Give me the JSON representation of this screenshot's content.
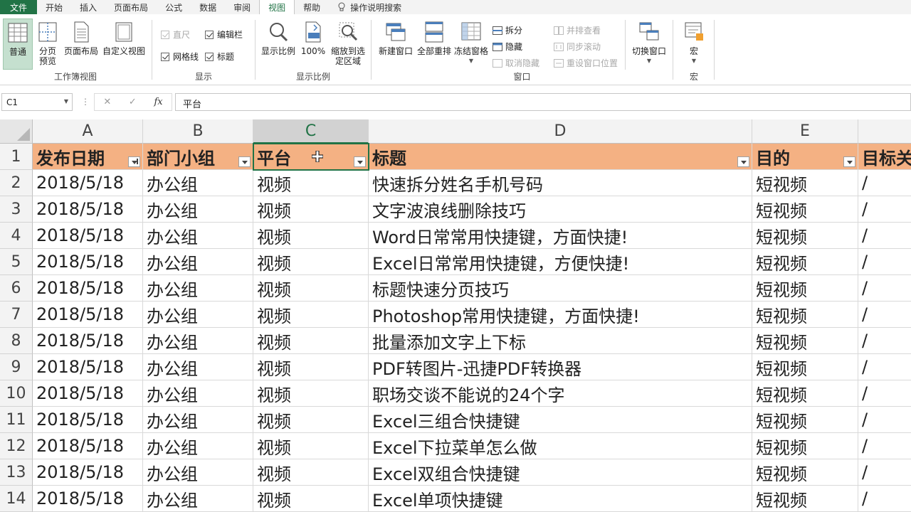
{
  "tabs": [
    "文件",
    "开始",
    "插入",
    "页面布局",
    "公式",
    "数据",
    "审阅",
    "视图",
    "帮助",
    "操作说明搜索"
  ],
  "ribbon": {
    "workbook_views": {
      "label": "工作簿视图",
      "buttons": [
        "普通",
        "分页预览",
        "页面布局",
        "自定义视图"
      ]
    },
    "show": {
      "label": "显示",
      "checks": [
        {
          "label": "直尺",
          "checked": true,
          "disabled": true
        },
        {
          "label": "编辑栏",
          "checked": true,
          "disabled": false
        },
        {
          "label": "网格线",
          "checked": true,
          "disabled": false
        },
        {
          "label": "标题",
          "checked": true,
          "disabled": false
        }
      ]
    },
    "zoom": {
      "label": "显示比例",
      "buttons": [
        "显示比例",
        "100%",
        "缩放到选定区域"
      ]
    },
    "window": {
      "label": "窗口",
      "buttons": [
        "新建窗口",
        "全部重排",
        "冻结窗格"
      ],
      "small": [
        "拆分",
        "隐藏",
        "取消隐藏"
      ],
      "small2": [
        "并排查看",
        "同步滚动",
        "重设窗口位置"
      ],
      "switch": "切换窗口"
    },
    "macro": {
      "label": "宏",
      "button": "宏"
    }
  },
  "formula_bar": {
    "name_box": "C1",
    "cancel": "✕",
    "enter": "✓",
    "fx": "fx",
    "content": "平台"
  },
  "columns": [
    "A",
    "B",
    "C",
    "D",
    "E",
    ""
  ],
  "headers": [
    "发布日期",
    "部门小组",
    "平台",
    "标题",
    "目的",
    "目标关"
  ],
  "rows": [
    {
      "n": "2",
      "cells": [
        "2018/5/18",
        "办公组",
        "视频",
        "快速拆分姓名手机号码",
        "短视频",
        "/"
      ]
    },
    {
      "n": "3",
      "cells": [
        "2018/5/18",
        "办公组",
        "视频",
        "文字波浪线删除技巧",
        "短视频",
        "/"
      ]
    },
    {
      "n": "4",
      "cells": [
        "2018/5/18",
        "办公组",
        "视频",
        "Word日常常用快捷键，方面快捷!",
        "短视频",
        "/"
      ]
    },
    {
      "n": "5",
      "cells": [
        "2018/5/18",
        "办公组",
        "视频",
        "Excel日常常用快捷键，方便快捷!",
        "短视频",
        "/"
      ]
    },
    {
      "n": "6",
      "cells": [
        "2018/5/18",
        "办公组",
        "视频",
        "标题快速分页技巧",
        "短视频",
        "/"
      ]
    },
    {
      "n": "7",
      "cells": [
        "2018/5/18",
        "办公组",
        "视频",
        "Photoshop常用快捷键，方面快捷!",
        "短视频",
        "/"
      ]
    },
    {
      "n": "8",
      "cells": [
        "2018/5/18",
        "办公组",
        "视频",
        "批量添加文字上下标",
        "短视频",
        "/"
      ]
    },
    {
      "n": "9",
      "cells": [
        "2018/5/18",
        "办公组",
        "视频",
        "PDF转图片-迅捷PDF转换器",
        "短视频",
        "/"
      ]
    },
    {
      "n": "10",
      "cells": [
        "2018/5/18",
        "办公组",
        "视频",
        "职场交谈不能说的24个字",
        "短视频",
        "/"
      ]
    },
    {
      "n": "11",
      "cells": [
        "2018/5/18",
        "办公组",
        "视频",
        "Excel三组合快捷键",
        "短视频",
        "/"
      ]
    },
    {
      "n": "12",
      "cells": [
        "2018/5/18",
        "办公组",
        "视频",
        "Excel下拉菜单怎么做",
        "短视频",
        "/"
      ]
    },
    {
      "n": "13",
      "cells": [
        "2018/5/18",
        "办公组",
        "视频",
        "Excel双组合快捷键",
        "短视频",
        "/"
      ]
    },
    {
      "n": "14",
      "cells": [
        "2018/5/18",
        "办公组",
        "视频",
        "Excel单项快捷键",
        "短视频",
        "/"
      ]
    }
  ],
  "header_row_number": "1",
  "colors": {
    "accent": "#217346",
    "header_fill": "#f4b183",
    "selected_ribbon": "#c5e0cf"
  }
}
